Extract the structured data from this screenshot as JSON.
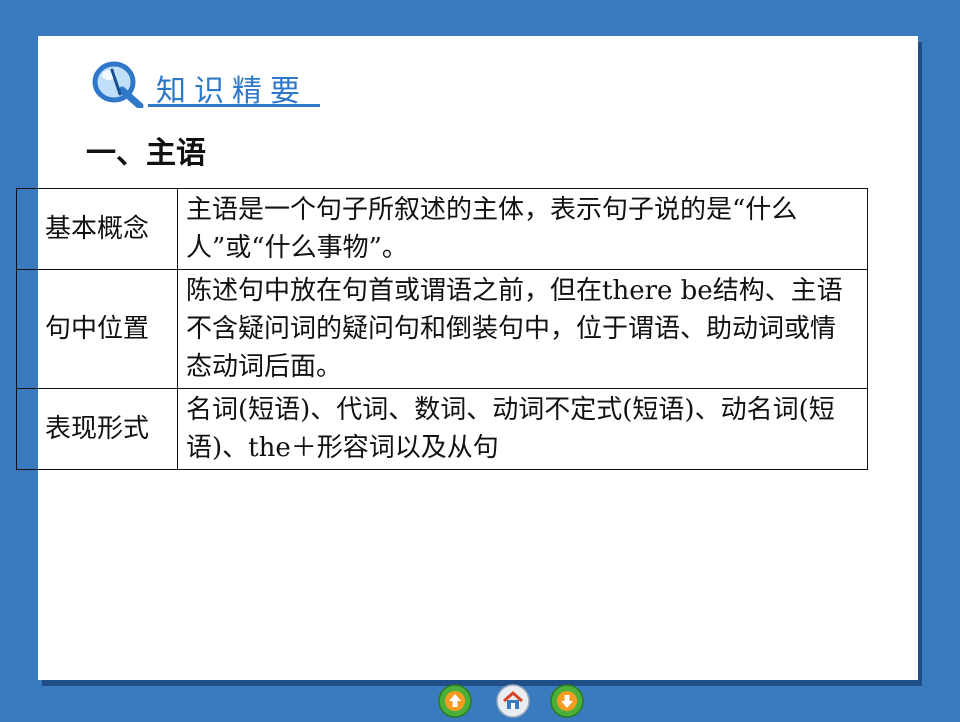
{
  "header": {
    "badge_text": "知识精要"
  },
  "section": {
    "title": "一、主语"
  },
  "table": {
    "rows": [
      {
        "label": "基本概念",
        "text": "主语是一个句子所叙述的主体，表示句子说的是“什么人”或“什么事物”。"
      },
      {
        "label": "句中位置",
        "text": "陈述句中放在句首或谓语之前，但在there be结构、主语不含疑问词的疑问句和倒装句中，位于谓语、助动词或情态动词后面。"
      },
      {
        "label": "表现形式",
        "text": "名词(短语)、代词、数词、动词不定式(短语)、动名词(短语)、the＋形容词以及从句"
      }
    ]
  },
  "nav": {
    "prev_icon": "up-arrow-icon",
    "home_icon": "home-icon",
    "next_icon": "down-arrow-icon"
  },
  "colors": {
    "background": "#3a7bbf",
    "accent": "#2f78c9",
    "nav_green": "#4caf3a",
    "nav_orange": "#f39c21"
  }
}
